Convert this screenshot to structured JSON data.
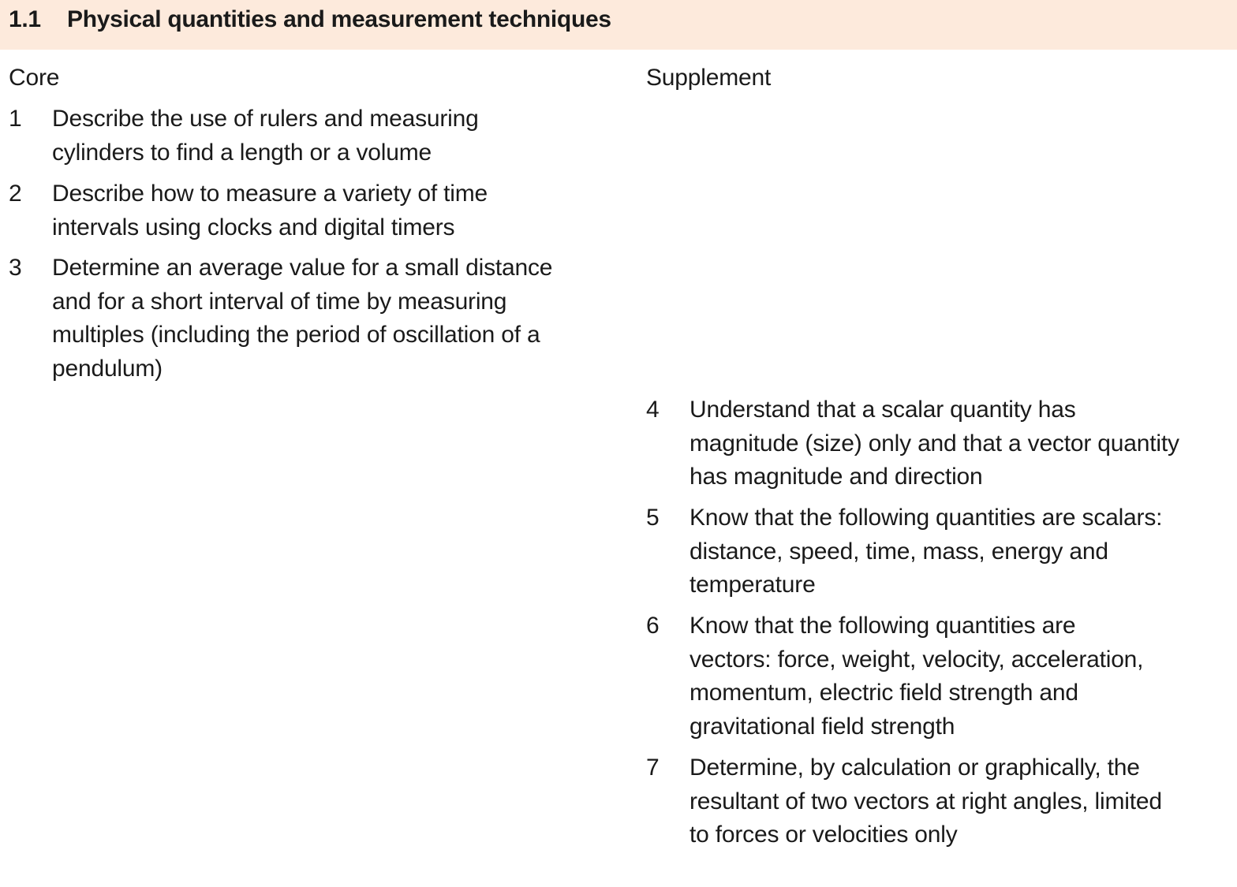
{
  "section": {
    "number": "1.1",
    "title": "Physical quantities and measurement techniques"
  },
  "columns": {
    "core_heading": "Core",
    "supplement_heading": "Supplement"
  },
  "core_items": [
    {
      "number": "1",
      "lines": [
        "Describe the use of rulers and measuring",
        "cylinders to find a length or a volume"
      ]
    },
    {
      "number": "2",
      "lines": [
        "Describe how to measure a variety of time",
        "intervals using clocks and digital timers"
      ]
    },
    {
      "number": "3",
      "lines": [
        "Determine an average value for a small distance",
        "and for a short interval of time by measuring",
        "multiples (including the period of oscillation of a",
        "pendulum)"
      ]
    }
  ],
  "supplement_items": [
    {
      "number": "4",
      "lines": [
        "Understand that a scalar quantity has",
        "magnitude (size) only and that a vector quantity",
        "has magnitude and direction"
      ]
    },
    {
      "number": "5",
      "lines": [
        "Know that the following quantities are scalars:",
        "distance, speed, time, mass, energy and",
        "temperature"
      ]
    },
    {
      "number": "6",
      "lines": [
        "Know that the following quantities are",
        "vectors: force, weight, velocity, acceleration,",
        "momentum, electric field strength and",
        "gravitational field strength"
      ]
    },
    {
      "number": "7",
      "lines": [
        "Determine, by calculation or graphically, the",
        "resultant of two vectors at right angles, limited",
        "to forces or velocities only"
      ]
    }
  ],
  "colors": {
    "header_background": "#fdeadc",
    "text": "#1a1a1a"
  }
}
